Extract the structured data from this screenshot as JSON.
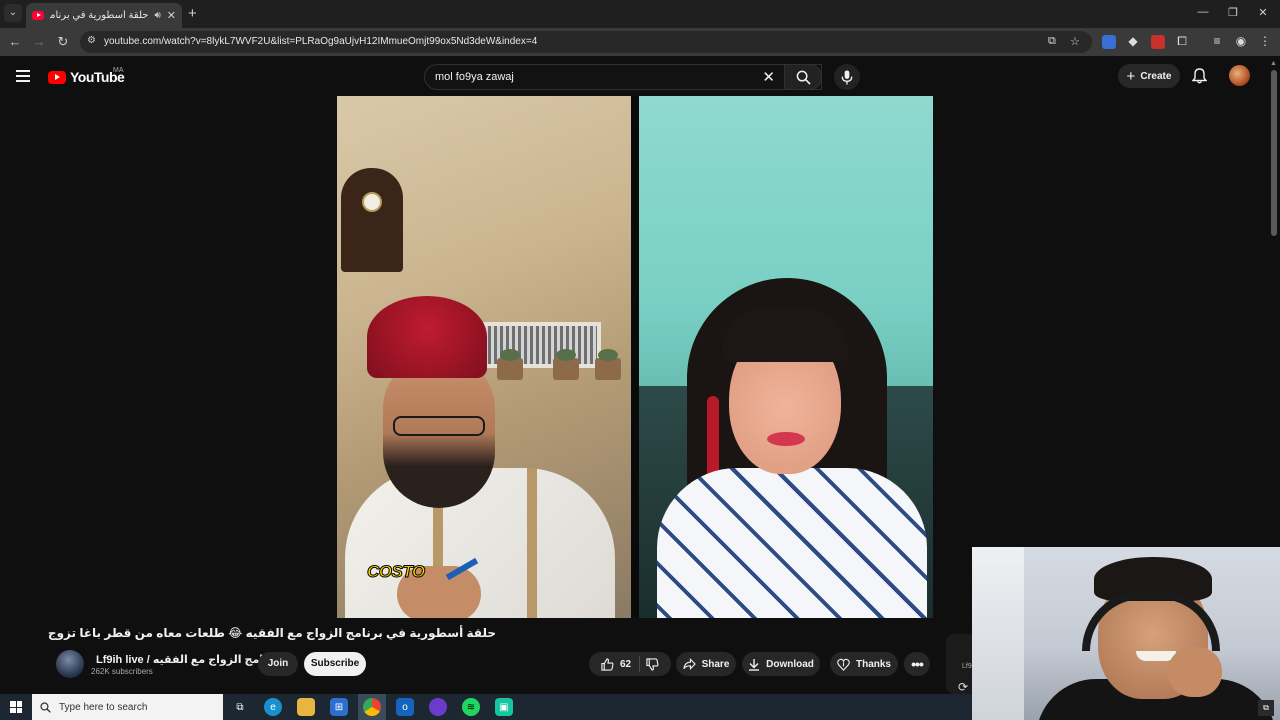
{
  "browser": {
    "tab_title": "حلقة أسطورية في برنامج الز...",
    "url": "youtube.com/watch?v=8lykL7WVF2U&list=PLRaOg9aUjvH12IMmueOmjt99ox5Nd3deW&index=4"
  },
  "header": {
    "logo_text": "YouTube",
    "country": "MA",
    "search_value": "mol fo9ya zawaj",
    "create_label": "Create"
  },
  "video": {
    "sticker_text": "COSTO",
    "title": "حلقة أسطورية في برنامج الزواج مع الفقيه 😂 طلعات معاه من قطر باغا تزوج"
  },
  "channel": {
    "name": "Lf9ih live / برنامج الزواج مع الفقيه",
    "subscribers": "262K subscribers",
    "join_label": "Join",
    "subscribe_label": "Subscribe"
  },
  "actions": {
    "like_count": "62",
    "share_label": "Share",
    "download_label": "Download",
    "thanks_label": "Thanks"
  },
  "sidebar_peek": {
    "text": "Lf9"
  },
  "taskbar": {
    "search_placeholder": "Type here to search"
  },
  "colors": {
    "yt_red": "#ff0000",
    "background": "#0f0f0f",
    "pill": "#272727"
  }
}
